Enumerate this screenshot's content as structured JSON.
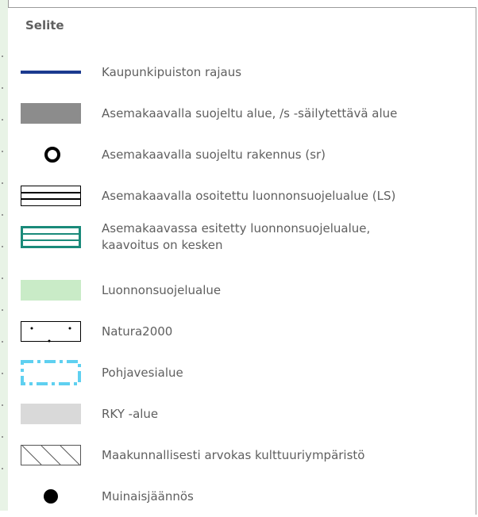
{
  "legend": {
    "title": "Selite",
    "items": [
      {
        "symbol": "line-icon",
        "color": "#1b3a8f",
        "label": "Kaupunkipuiston rajaus"
      },
      {
        "symbol": "gray-fill-icon",
        "color": "#8c8c8c",
        "label": "Asemakaavalla suojeltu alue, /s -säilytettävä alue"
      },
      {
        "symbol": "ring-icon",
        "color": "#000000",
        "label": "Asemakaavalla suojeltu rakennus (sr)"
      },
      {
        "symbol": "double-line-rect-icon",
        "color": "#000000",
        "label": "Asemakaavalla osoitettu luonnonsuojelualue (LS)"
      },
      {
        "symbol": "teal-double-rect-icon",
        "color": "#1a8a7a",
        "label": "Asemakaavassa esitetty luonnonsuojelualue, kaavoitus on kesken"
      },
      {
        "symbol": "green-fill-icon",
        "color": "#c9ebc7",
        "label": "Luonnonsuojelualue"
      },
      {
        "symbol": "dotted-rect-icon",
        "color": "#000000",
        "label": "Natura2000"
      },
      {
        "symbol": "dashed-rect-icon",
        "color": "#5fd0f0",
        "label": "Pohjavesialue"
      },
      {
        "symbol": "light-gray-fill-icon",
        "color": "#d9d9d9",
        "label": "RKY -alue"
      },
      {
        "symbol": "hatch-rect-icon",
        "color": "#555555",
        "label": "Maakunnallisesti arvokas kulttuuriympäristö"
      },
      {
        "symbol": "dot-icon",
        "color": "#000000",
        "label": "Muinaisjäännös"
      }
    ]
  }
}
